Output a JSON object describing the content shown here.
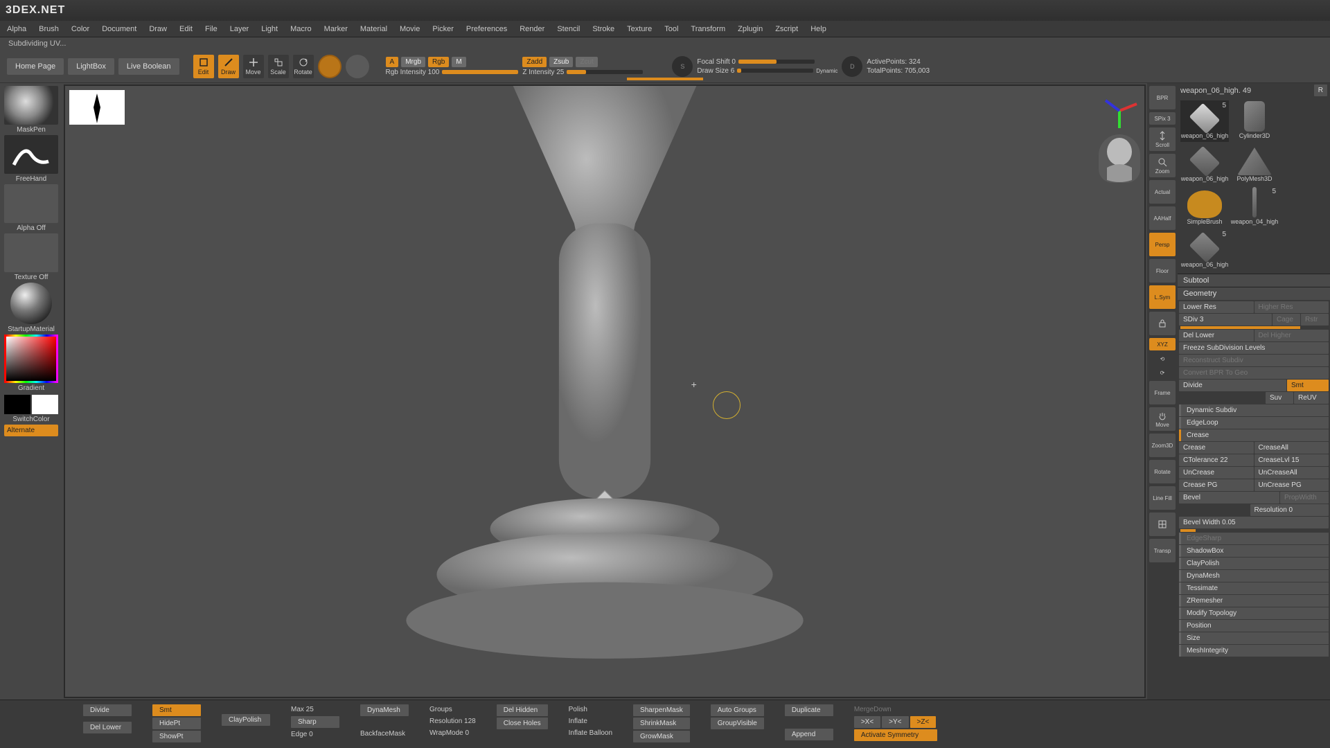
{
  "brand": "3DEX.NET",
  "menu": [
    "Alpha",
    "Brush",
    "Color",
    "Document",
    "Draw",
    "Edit",
    "File",
    "Layer",
    "Light",
    "Macro",
    "Marker",
    "Material",
    "Movie",
    "Picker",
    "Preferences",
    "Render",
    "Stencil",
    "Stroke",
    "Texture",
    "Tool",
    "Transform",
    "Zplugin",
    "Zscript",
    "Help"
  ],
  "status": "Subdividing UV...",
  "toolbar": {
    "home": "Home Page",
    "lightbox": "LightBox",
    "live_boolean": "Live Boolean",
    "edit": "Edit",
    "draw": "Draw",
    "move": "Move",
    "scale": "Scale",
    "rotate": "Rotate",
    "a": "A",
    "mrgb": "Mrgb",
    "rgb": "Rgb",
    "m": "M",
    "rgb_intensity_label": "Rgb Intensity 100",
    "zadd": "Zadd",
    "zsub": "Zsub",
    "zcut": "Zcut",
    "z_intensity_label": "Z Intensity 25",
    "focal_shift": "Focal Shift 0",
    "draw_size": "Draw Size 6",
    "dynamic": "Dynamic",
    "active_points": "ActivePoints: 324",
    "total_points": "TotalPoints: 705,003"
  },
  "left": {
    "brush": "MaskPen",
    "stroke": "FreeHand",
    "alpha": "Alpha Off",
    "texture": "Texture Off",
    "material": "StartupMaterial",
    "gradient": "Gradient",
    "switch": "SwitchColor",
    "alternate": "Alternate"
  },
  "nav": {
    "bpr": "BPR",
    "spix": "SPix 3",
    "scroll": "Scroll",
    "zoom": "Zoom",
    "actual": "Actual",
    "aahalf": "AAHalf",
    "persp": "Persp",
    "floor": "Floor",
    "lsym": "L.Sym",
    "xyz": "XYZ",
    "frame": "Frame",
    "move": "Move",
    "zoom3d": "Zoom3D",
    "rotate": "Rotate",
    "linefill": "Line Fill",
    "transp": "Transp"
  },
  "subtool_title": "weapon_06_high. 49",
  "subtools": [
    {
      "name": "weapon_06_high",
      "count": "5"
    },
    {
      "name": "Cylinder3D",
      "count": ""
    },
    {
      "name": "weapon_06_high",
      "count": ""
    },
    {
      "name": "PolyMesh3D",
      "count": ""
    },
    {
      "name": "SimpleBrush",
      "count": ""
    },
    {
      "name": "weapon_04_high",
      "count": "5"
    },
    {
      "name": "weapon_06_high",
      "count": "5"
    }
  ],
  "panels": {
    "subtool": "Subtool",
    "geometry": "Geometry",
    "lower_res": "Lower Res",
    "higher_res": "Higher Res",
    "sdiv": "SDiv 3",
    "cage": "Cage",
    "rstr": "Rstr",
    "del_lower": "Del Lower",
    "del_higher": "Del Higher",
    "freeze": "Freeze SubDivision Levels",
    "reconstruct": "Reconstruct Subdiv",
    "convert": "Convert BPR To Geo",
    "divide": "Divide",
    "smt": "Smt",
    "suv": "Suv",
    "reuv": "ReUV",
    "dynamic_subdiv": "Dynamic Subdiv",
    "edgeloop": "EdgeLoop",
    "crease_hdr": "Crease",
    "crease": "Crease",
    "crease_all": "CreaseAll",
    "ctolerance": "CTolerance 22",
    "crease_lvl": "CreaseLvl 15",
    "uncrease": "UnCrease",
    "uncrease_all": "UnCreaseAll",
    "crease_pg": "Crease PG",
    "uncrease_pg": "UnCrease PG",
    "bevel": "Bevel",
    "propwidth": "PropWidth",
    "resolution": "Resolution 0",
    "bevel_width": "Bevel Width 0.05",
    "edgesharp": "EdgeSharp",
    "shadowbox": "ShadowBox",
    "claypolish": "ClayPolish",
    "dynamesh": "DynaMesh",
    "tessimate": "Tessimate",
    "zremesher": "ZRemesher",
    "modify_topology": "Modify Topology",
    "position": "Position",
    "size": "Size",
    "meshintegrity": "MeshIntegrity"
  },
  "shelf": {
    "divide": "Divide",
    "del_lower": "Del Lower",
    "smt": "Smt",
    "hidept": "HidePt",
    "showpt": "ShowPt",
    "claypolish": "ClayPolish",
    "max": "Max 25",
    "sharp": "Sharp",
    "edge0": "Edge 0",
    "dynamesh": "DynaMesh",
    "backface": "BackfaceMask",
    "groups": "Groups",
    "resolution": "Resolution 128",
    "wrapmode": "WrapMode 0",
    "del_hidden": "Del Hidden",
    "close_holes": "Close Holes",
    "polish": "Polish",
    "inflate": "Inflate",
    "inflate_balloon": "Inflate Balloon",
    "sharpen_mask": "SharpenMask",
    "shrink_mask": "ShrinkMask",
    "grow_mask": "GrowMask",
    "auto_groups": "Auto Groups",
    "group_visible": "GroupVisible",
    "duplicate": "Duplicate",
    "append": "Append",
    "merge_down": "MergeDown",
    "x": ">X<",
    "y": ">Y<",
    "z": ">Z<",
    "activate_sym": "Activate Symmetry"
  }
}
